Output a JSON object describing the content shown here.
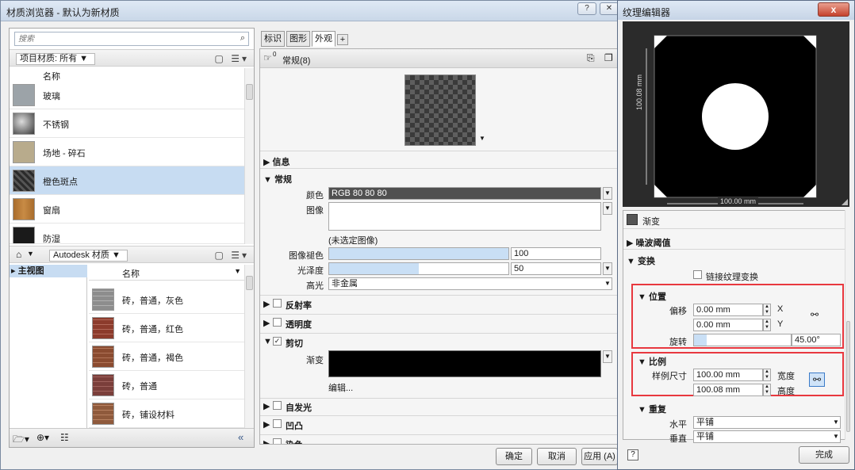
{
  "main_window": {
    "title": "材质浏览器 - 默认为新材质",
    "help_btn": "?",
    "close_btn": "✕"
  },
  "left": {
    "search_placeholder": "搜索",
    "project_crumb": "项目材质: 所有 ▼",
    "header_name": "名称",
    "project_materials": [
      {
        "label": "玻璃",
        "color": "#9ca3a8"
      },
      {
        "label": "不锈钢",
        "color": "#5d5d5d"
      },
      {
        "label": "场地 - 碎石",
        "color": "#b8ab8c"
      },
      {
        "label": "橙色斑点",
        "color": "#3c3c3c"
      },
      {
        "label": "窗扇",
        "color": "#b47a3a"
      },
      {
        "label": "防湿",
        "color": "#1a1a1a"
      }
    ],
    "library_crumb_home": "▼",
    "library_crumb": "Autodesk 材质 ▼",
    "tree_item": "▸ 主视图",
    "library_header_name": "名称",
    "library_materials": [
      {
        "label": "砖，普通，灰色",
        "color": "#8d8d8d"
      },
      {
        "label": "砖，普通，红色",
        "color": "#8c3b2c"
      },
      {
        "label": "砖，普通，褐色",
        "color": "#8a4b30"
      },
      {
        "label": "砖，普通",
        "color": "#7a3e3a"
      },
      {
        "label": "砖，铺设材料",
        "color": "#8f5a3c"
      }
    ],
    "collapse_btn": "«"
  },
  "tabs": [
    {
      "label": "标识"
    },
    {
      "label": "图形"
    },
    {
      "label": "外观"
    },
    {
      "label": "+"
    }
  ],
  "props": {
    "asset_count": "0",
    "asset_name": "常规(8)",
    "sections": {
      "info": "▶ 信息",
      "general": "▼ 常规",
      "reflectivity": "▶",
      "reflectivity_label": "反射率",
      "transparency": "▶",
      "transparency_label": "透明度",
      "cutout": "▼",
      "cutout_label": "剪切",
      "self_illum": "▶",
      "self_illum_label": "自发光",
      "bump": "▶",
      "bump_label": "凹凸",
      "tint": "▶",
      "tint_label": "染色"
    },
    "color_label": "颜色",
    "color_value": "RGB 80 80 80",
    "image_label": "图像",
    "image_none": "(未选定图像)",
    "image_fade_label": "图像褪色",
    "image_fade_value": "100",
    "image_fade_pct": 100,
    "glossiness_label": "光泽度",
    "glossiness_value": "50",
    "glossiness_pct": 50,
    "highlight_label": "高光",
    "highlight_value": "非金属",
    "gradient_label": "渐变",
    "edit_link": "编辑...",
    "check_mark": "✓"
  },
  "buttons": {
    "ok": "确定",
    "cancel": "取消",
    "apply": "应用 (A)"
  },
  "texture_editor": {
    "title": "纹理编辑器",
    "close": "x",
    "dim_width": "100.00 mm",
    "dim_height": "100.08 mm",
    "gradient_label": "渐变",
    "noise_threshold": "▶ 噪波阈值",
    "transform": "▼ 变换",
    "link_transform": "链接纹理变换",
    "position": "▼ 位置",
    "offset_label": "偏移",
    "offset_x": "0.00 mm",
    "offset_x_axis": "X",
    "offset_y": "0.00 mm",
    "offset_y_axis": "Y",
    "rotation_label": "旋转",
    "rotation_value": "45.00°",
    "scale": "▼ 比例",
    "sample_size_label": "样例尺寸",
    "width_value": "100.00 mm",
    "width_label": "宽度",
    "height_value": "100.08 mm",
    "height_label": "高度",
    "repeat": "▼ 重复",
    "horizontal_label": "水平",
    "horizontal_value": "平铺",
    "vertical_label": "垂直",
    "vertical_value": "平铺",
    "help": "?",
    "done": "完成"
  },
  "colors": {
    "selection": "#c7dcf2",
    "highlight_box": "#e8383f",
    "title_gradient": "#dfe9f5"
  }
}
